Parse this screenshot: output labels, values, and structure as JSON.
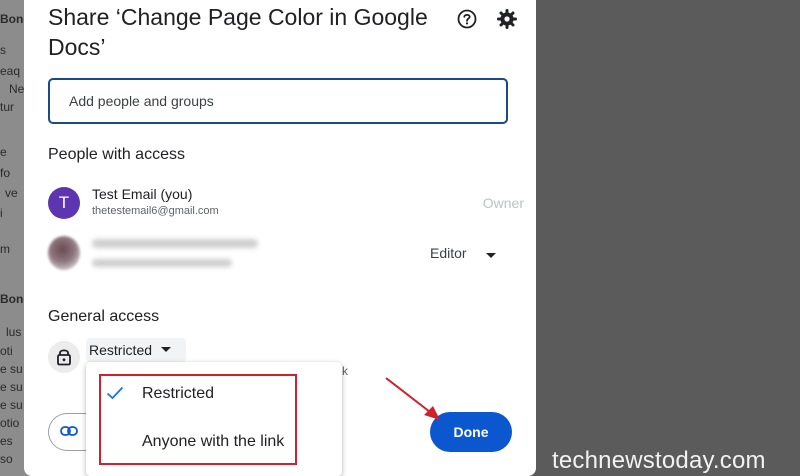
{
  "background_doc": {
    "fragments": [
      {
        "text": "Bond",
        "bold": true
      },
      {
        "text": "s",
        "bold": false
      },
      {
        "text": "eaq",
        "bold": false
      },
      {
        "text": "Ne",
        "bold": false
      },
      {
        "text": "tur",
        "bold": false
      },
      {
        "text": "e",
        "bold": false
      },
      {
        "text": "fo",
        "bold": false
      },
      {
        "text": "ve",
        "bold": false
      },
      {
        "text": "i",
        "bold": false
      },
      {
        "text": "m",
        "bold": false
      },
      {
        "text": "Bond",
        "bold": true
      },
      {
        "text": "lus",
        "bold": false
      },
      {
        "text": "oti",
        "bold": false
      },
      {
        "text": "e su",
        "bold": false
      },
      {
        "text": "e su",
        "bold": false
      },
      {
        "text": "e su",
        "bold": false
      },
      {
        "text": "otio",
        "bold": false
      },
      {
        "text": "es",
        "bold": false
      },
      {
        "text": "so",
        "bold": false
      }
    ]
  },
  "dialog": {
    "title": "Share ‘Change Page Color in Google Docs’",
    "help_icon": "help-circle-icon",
    "settings_icon": "gear-icon",
    "add_people_placeholder": "Add people and groups",
    "people_heading": "People with access",
    "people": [
      {
        "initial": "T",
        "name": "Test Email (you)",
        "email": "thetestemail6@gmail.com",
        "role": "Owner"
      },
      {
        "role": "Editor"
      }
    ],
    "general_access_heading": "General access",
    "general_access_value": "Restricted",
    "general_access_desc": "k",
    "done_label": "Done"
  },
  "dropdown": {
    "options": [
      {
        "label": "Restricted",
        "selected": true
      },
      {
        "label": "Anyone with the link",
        "selected": false
      }
    ]
  },
  "colors": {
    "accent": "#0b57d0",
    "avatar": "#5e35b1",
    "highlight": "#d0202e"
  },
  "watermark": "technewstoday.com"
}
